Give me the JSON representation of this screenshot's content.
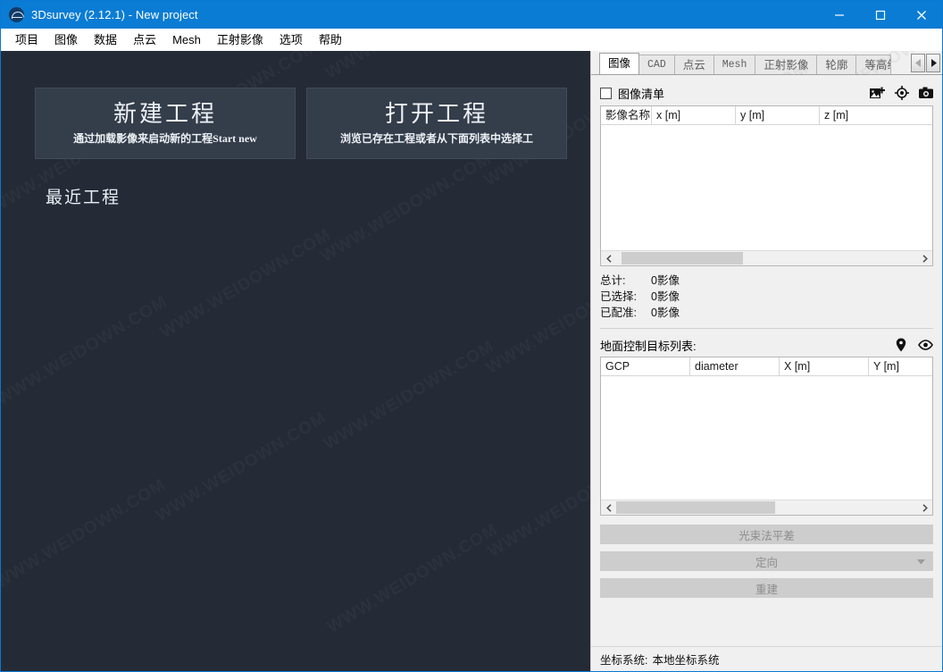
{
  "window": {
    "title": "3Dsurvey (2.12.1) - New project",
    "logo_icon": "3dsurvey-logo-icon",
    "minimize_icon": "minimize-icon",
    "maximize_icon": "maximize-icon",
    "close_icon": "close-icon"
  },
  "menubar": {
    "items": [
      {
        "label": "项目"
      },
      {
        "label": "图像"
      },
      {
        "label": "数据"
      },
      {
        "label": "点云"
      },
      {
        "label": "Mesh"
      },
      {
        "label": "正射影像"
      },
      {
        "label": "选项"
      },
      {
        "label": "帮助"
      }
    ]
  },
  "start_panel": {
    "background_color": "#242b36",
    "tiles": [
      {
        "title": "新建工程",
        "subtitle": "通过加载影像来启动新的工程Start new"
      },
      {
        "title": "打开工程",
        "subtitle": "浏览已存在工程或者从下面列表中选择工"
      }
    ],
    "recent_label": "最近工程",
    "watermark_text": "WWW.WEIDOWN.COM"
  },
  "right_panel": {
    "tabs": [
      {
        "label": "图像",
        "active": true,
        "mono": false
      },
      {
        "label": "CAD",
        "active": false,
        "mono": true
      },
      {
        "label": "点云",
        "active": false,
        "mono": false
      },
      {
        "label": "Mesh",
        "active": false,
        "mono": true
      },
      {
        "label": "正射影像",
        "active": false,
        "mono": false
      },
      {
        "label": "轮廓",
        "active": false,
        "mono": false
      },
      {
        "label": "等高线",
        "active": false,
        "mono": false
      }
    ],
    "tab_prev_icon": "chevron-left-icon",
    "tab_next_icon": "chevron-right-icon",
    "image_list": {
      "checkbox_label": "图像清单",
      "checked": false,
      "icons": [
        {
          "name": "add-image-icon"
        },
        {
          "name": "target-icon"
        },
        {
          "name": "camera-icon"
        }
      ],
      "columns": [
        "影像名称",
        "x [m]",
        "y [m]",
        "z [m]"
      ],
      "rows": []
    },
    "stats": [
      {
        "key": "总计:",
        "value": "0影像"
      },
      {
        "key": "已选择:",
        "value": "0影像"
      },
      {
        "key": "已配准:",
        "value": "0影像"
      }
    ],
    "gcp": {
      "title": "地面控制目标列表:",
      "icons": [
        {
          "name": "map-pin-icon"
        },
        {
          "name": "eye-icon"
        }
      ],
      "columns": [
        "GCP",
        "diameter",
        "X [m]",
        "Y [m]"
      ],
      "rows": []
    },
    "actions": [
      {
        "label": "光束法平差",
        "type": "button"
      },
      {
        "label": "定向",
        "type": "dropdown"
      },
      {
        "label": "重建",
        "type": "button"
      }
    ]
  },
  "statusbar": {
    "key": "坐标系统:",
    "value": "本地坐标系统"
  }
}
